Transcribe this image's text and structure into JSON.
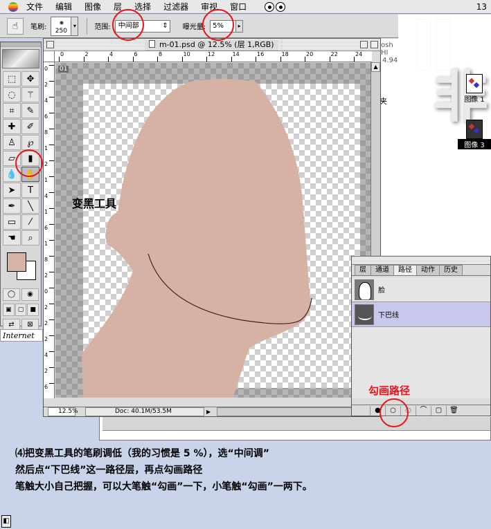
{
  "menubar": {
    "items": [
      "文件",
      "编辑",
      "图像",
      "层",
      "选择",
      "过滤器",
      "审视",
      "窗口"
    ],
    "clock": "13"
  },
  "options_bar": {
    "brush_label": "笔刷:",
    "brush_size": "250",
    "range_label": "范围:",
    "range_value": "中间部",
    "exposure_label": "曝光量:",
    "exposure_value": "5%"
  },
  "document": {
    "title": "m-01.psd @ 12.5% (层 1,RGB)",
    "layer_badge": "01",
    "ruler_top": [
      "0",
      "2",
      "4",
      "6",
      "8",
      "10",
      "12",
      "14",
      "16",
      "18",
      "20",
      "22",
      "24"
    ],
    "ruler_left": [
      "0",
      "2",
      "4",
      "6",
      "8",
      "1",
      "2",
      "1",
      "4",
      "1",
      "6",
      "1",
      "8",
      "2",
      "0",
      "2",
      "2",
      "2",
      "4",
      "2",
      "6"
    ],
    "zoom": "12.5%",
    "doc_size": "Doc: 40.1M/53.5M",
    "annotation": "变黑工具",
    "colors": {
      "skin": "#d6b2a4",
      "foreground": "#d7b3a6"
    }
  },
  "behind_window": {
    "t1": "osh HI",
    "t2": "4.94",
    "t3": "夹"
  },
  "desktop": {
    "icons": [
      {
        "label": "图像 1"
      },
      {
        "label": "图像 3"
      }
    ]
  },
  "paths_palette": {
    "tabs": [
      "层",
      "通道",
      "路径",
      "动作",
      "历史"
    ],
    "active_tab": "路径",
    "items": [
      {
        "name": "脸",
        "selected": false
      },
      {
        "name": "下巴线",
        "selected": true
      }
    ],
    "annotation": "勾画路径"
  },
  "ie_tab": "Internet",
  "notes": [
    "⑷把变黑工具的笔刷调低（我的习惯是 5 %），选“中间调”",
    "然后点“下巴线”这一路径层，再点勾画路径",
    "笔触大小自己把握，可以大笔触“勾画”一下，小笔触“勾画”一两下。"
  ],
  "accent_color": "#e8141c"
}
